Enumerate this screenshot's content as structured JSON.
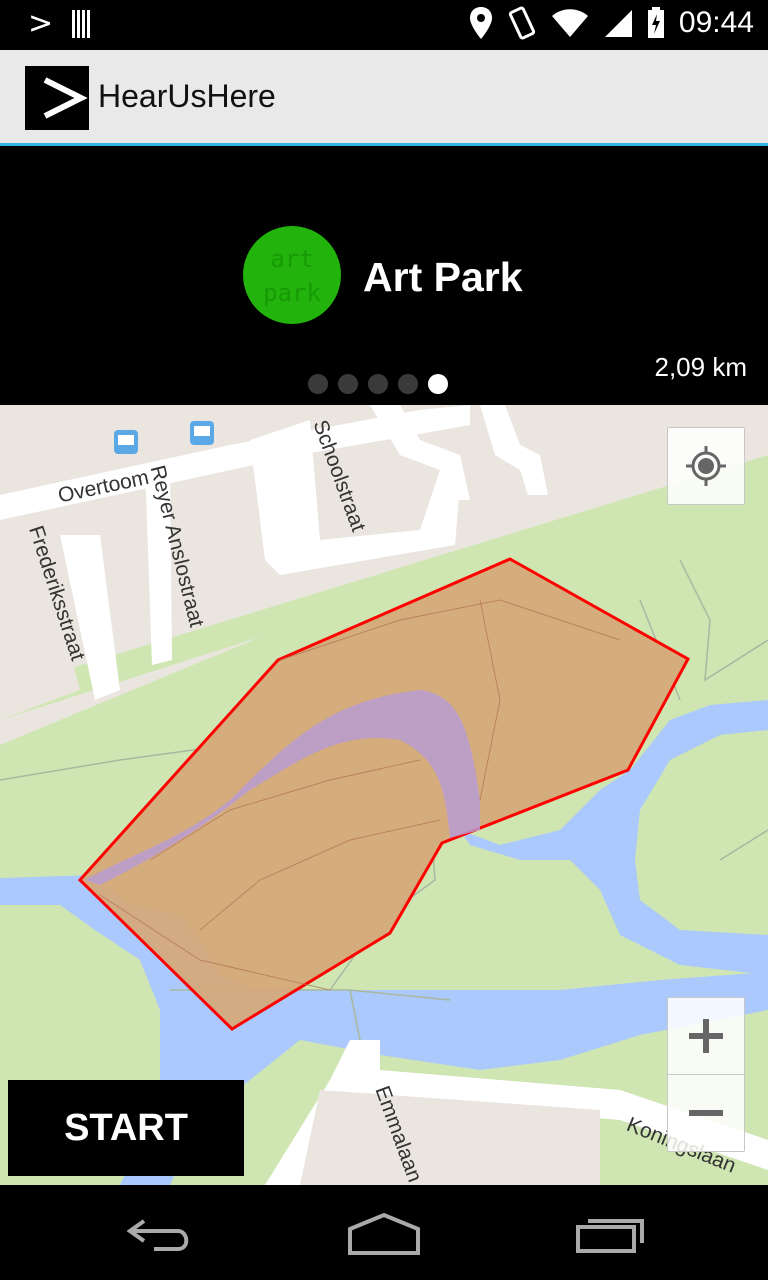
{
  "status_bar": {
    "time": "09:44",
    "icons": [
      "prompt-icon",
      "barcode-icon",
      "location-pin-icon",
      "vibrate-icon",
      "wifi-icon",
      "signal-icon",
      "battery-charging-icon"
    ]
  },
  "action_bar": {
    "title": "HearUsHere",
    "app_icon": "prompt-icon"
  },
  "banner": {
    "poi_logo_text": "art\npark",
    "poi_name": "Art Park",
    "distance": "2,09 km",
    "page_indicator": {
      "count": 5,
      "active_index": 4
    }
  },
  "map": {
    "street_labels": {
      "overtoom": "Overtoom",
      "reyer": "Reyer Anslostraat",
      "schoolstraat": "Schoolstraat",
      "frederiks": "Frederiksstraat",
      "emmalaan": "Emmalaan",
      "koningslaan": "Koningslaan"
    },
    "colors": {
      "park": "#cfe6b2",
      "water": "#abc9fc",
      "road": "#ffffff",
      "zone_fill": "#d6a878",
      "zone_border": "#ff0000",
      "path_highlight": "#b99bd0"
    },
    "controls": {
      "locate_icon": "crosshair-icon",
      "zoom_in_icon": "plus-icon",
      "zoom_out_icon": "minus-icon"
    }
  },
  "start_button": {
    "label": "START"
  },
  "nav_bar": {
    "icons": [
      "back-icon",
      "home-icon",
      "recent-apps-icon"
    ]
  }
}
